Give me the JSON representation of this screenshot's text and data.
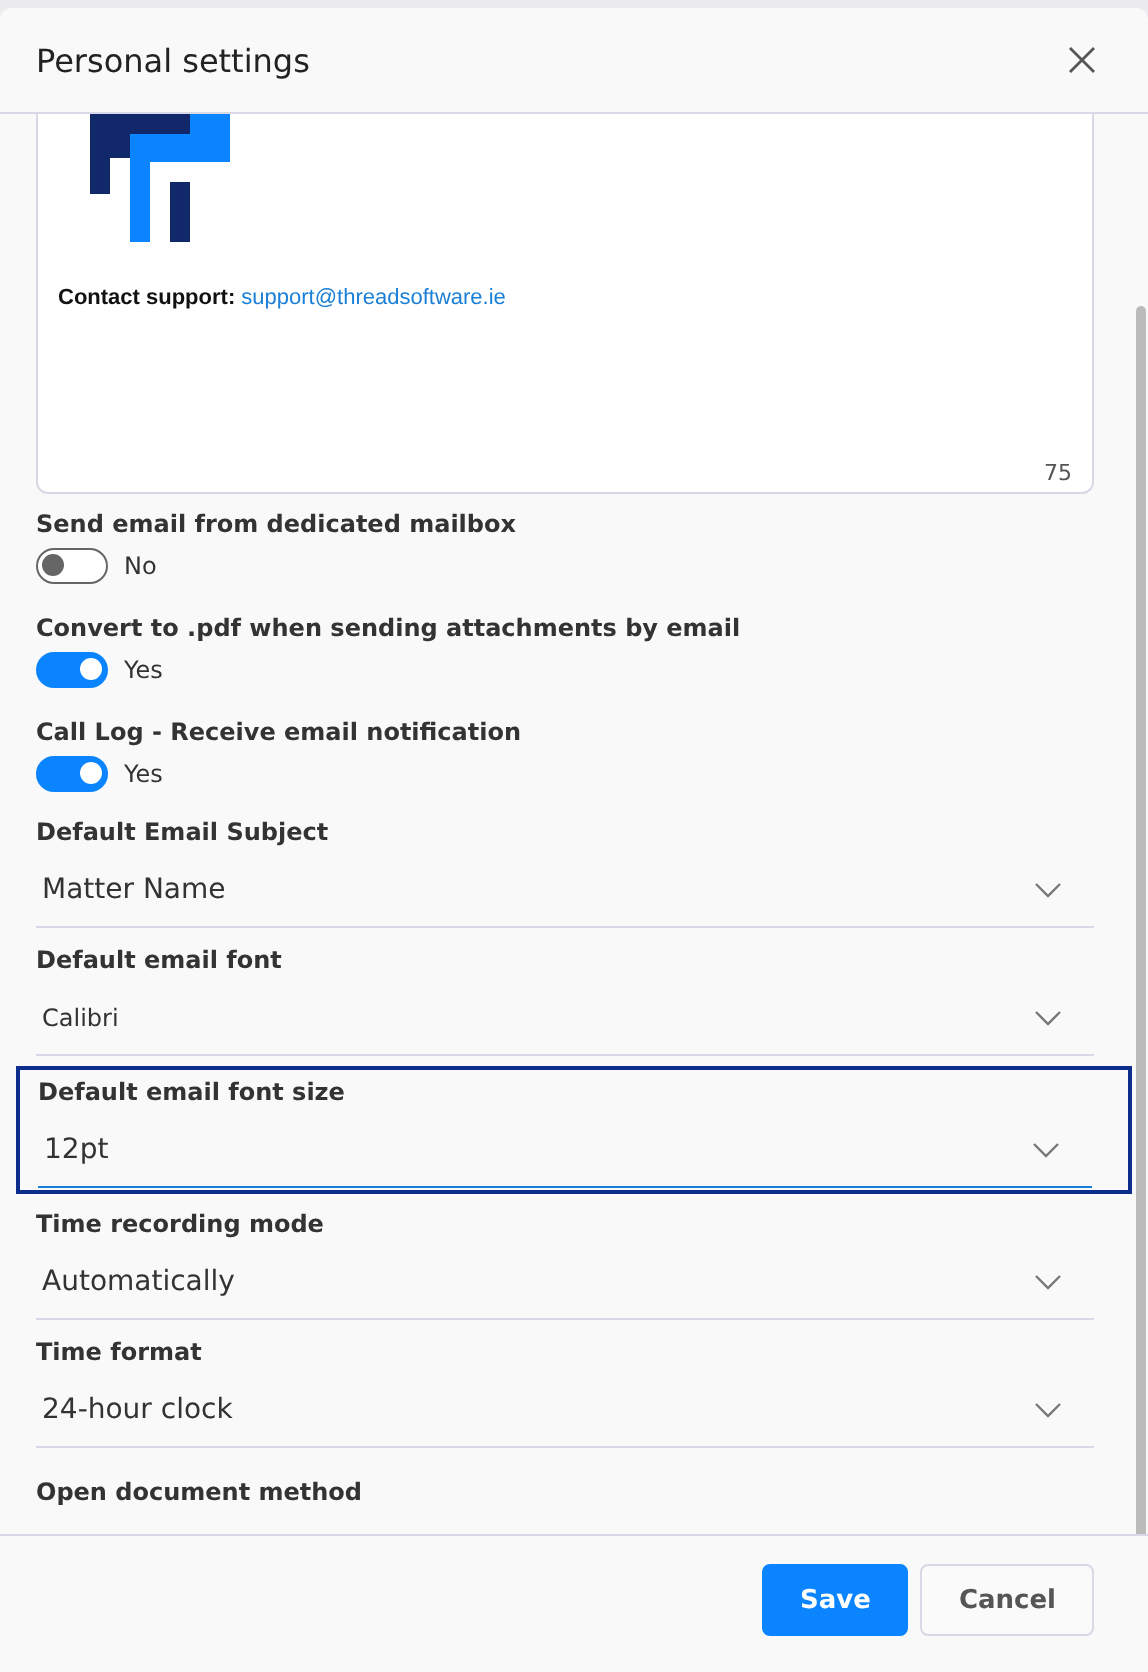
{
  "dialog": {
    "title": "Personal settings"
  },
  "signature": {
    "contact_text": "**Contact support:** ",
    "link": "support@threadsoftware.ie",
    "char_count": "75"
  },
  "settings": [
    {
      "kind": "toggle",
      "label": "Send email from dedicated mailbox",
      "on": false,
      "state_text": "No"
    },
    {
      "kind": "toggle",
      "label": "Convert to .pdf when sending attachments by email",
      "on": true,
      "state_text": "Yes"
    },
    {
      "kind": "toggle",
      "label": "Call Log - Receive email notification",
      "on": true,
      "state_text": "Yes"
    },
    {
      "kind": "select",
      "label": "Default Email Subject",
      "value": "Matter Name",
      "focused": false
    },
    {
      "kind": "select",
      "label": "Default email font",
      "value": "Calibri",
      "focused": false
    },
    {
      "kind": "select",
      "label": "Default email font size",
      "value": "12pt",
      "focused": true
    },
    {
      "kind": "select",
      "label": "Time recording mode",
      "value": "Automatically",
      "focused": false
    },
    {
      "kind": "select",
      "label": "Time format",
      "value": "24-hour clock",
      "focused": false
    },
    {
      "kind": "heading",
      "label": "Open document method"
    }
  ],
  "buttons": [
    {
      "kind": "primary",
      "label": "Save"
    },
    {
      "kind": "secondary",
      "label": "Cancel"
    }
  ]
}
